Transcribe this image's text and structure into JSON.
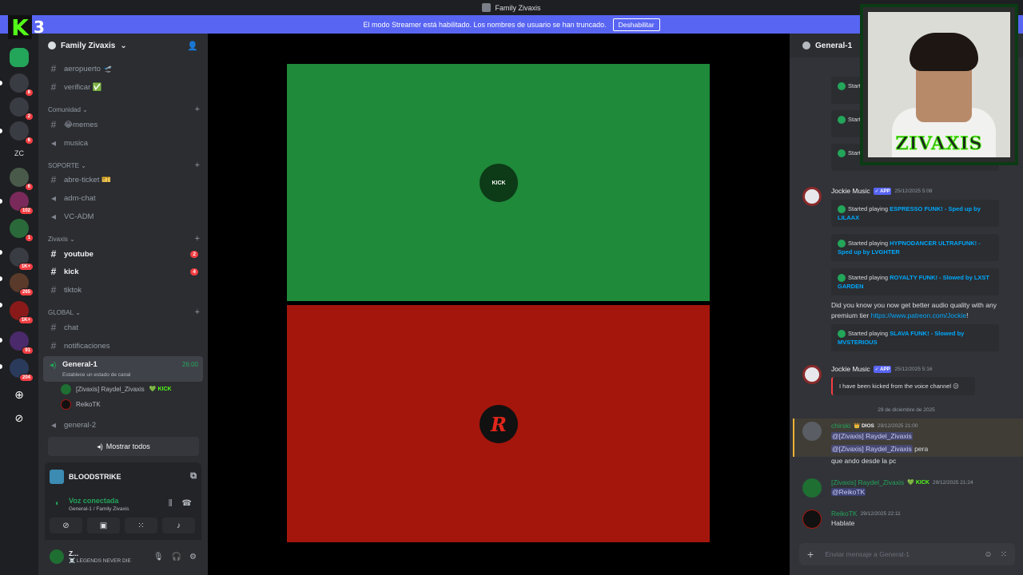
{
  "window": {
    "title": "Family Zivaxis"
  },
  "banner": {
    "text": "El modo Streamer está habilitado. Los nombres de usuario se han truncado.",
    "button": "Deshabilitar"
  },
  "overlay": {
    "kick_number": "3",
    "cam_brand": "ZIVAXIS"
  },
  "rail": {
    "servers": [
      {
        "label": "",
        "badge": ""
      },
      {
        "label": "",
        "badge": "8"
      },
      {
        "label": "",
        "badge": "2"
      },
      {
        "label": "",
        "badge": "6"
      },
      {
        "label": "ZC",
        "badge": ""
      },
      {
        "label": "",
        "badge": "6"
      },
      {
        "label": "",
        "badge": "102"
      },
      {
        "label": "",
        "badge": "1"
      },
      {
        "label": "",
        "badge": "1K+"
      },
      {
        "label": "",
        "badge": "265"
      },
      {
        "label": "",
        "badge": "1K+"
      },
      {
        "label": "",
        "badge": "91"
      },
      {
        "label": "",
        "badge": "204"
      }
    ]
  },
  "sidebar": {
    "guild_name": "Family Zivaxis",
    "channels_top": [
      {
        "name": "aeropuerto 🛫"
      },
      {
        "name": "verificar ✅"
      }
    ],
    "categories": {
      "comunidad": "Comunidad",
      "soporte": "SOPORTE",
      "zivaxis": "Zivaxis",
      "global": "GLOBAL"
    },
    "comunidad_channels": [
      "😂memes",
      "musica"
    ],
    "soporte_channels": [
      "abre-ticket 🎫",
      "adm-chat",
      "VC-ADM"
    ],
    "zivaxis_channels": [
      {
        "name": "youtube",
        "count": "2"
      },
      {
        "name": "kick",
        "count": "4"
      },
      {
        "name": "tiktok",
        "count": ""
      }
    ],
    "global_channels": [
      "chat",
      "notificaciones"
    ],
    "voice_channel": {
      "name": "General-1",
      "status": "Establece un estado de canal",
      "time": "26:00"
    },
    "voice_users": [
      {
        "name": "[Zivaxis] Raydel_Zivaxis",
        "tag": "💚 KICK"
      },
      {
        "name": "ReikoTK",
        "tag": ""
      }
    ],
    "general2": "general-2",
    "show_all": "Mostrar todos"
  },
  "activity": {
    "game": "BLOODSTRIKE"
  },
  "voice_panel": {
    "status": "Voz conectada",
    "sub": "General-1 / Family Zivaxis"
  },
  "user_panel": {
    "name": "Z...",
    "status": "☠️ LEGENDS NEVER DIE"
  },
  "chat": {
    "channel": "General-1",
    "messages": {
      "embed_top_partial": [
        "Started playing ... by A...",
        "Started playing ... sk8ta...",
        "Started playing ... Sped u..."
      ],
      "jockie1": {
        "author": "Jockie Music",
        "app": "✓ APP",
        "time": "25/12/2025 5:08",
        "embeds": [
          {
            "prefix": "Started playing ",
            "link": "ESPRESSO FUNK! - Sped up by LILAAX"
          },
          {
            "prefix": "Started playing ",
            "link": "HYPNODANCER ULTRAFUNK! - Sped up by LVGHTER"
          },
          {
            "prefix": "Started playing ",
            "link": "ROYALTY FUNK! - Slowed by LXST GARDEN"
          }
        ],
        "text": "Did you know you now get better audio quality with any premium tier ",
        "url": "https://www.patreon.com/Jockie",
        "embed4": {
          "prefix": "Started playing ",
          "link": "SLAVA FUNK! - Slowed by MVSTERIOUS"
        }
      },
      "jockie2": {
        "author": "Jockie Music",
        "app": "✓ APP",
        "time": "25/12/2025 5:16",
        "text": "I have been kicked from the voice channel 😕"
      },
      "date_divider": "29 de diciembre de 2025",
      "chirski": {
        "author": "chirski",
        "role": "👑 DIOS",
        "time": "29/12/2025 21:00",
        "mention1": "@[Zivaxis] Raydel_Zivaxis",
        "mention2": "@[Zivaxis] Raydel_Zivaxis",
        "text2": " pera",
        "text3": "que ando desde la pc"
      },
      "raydel": {
        "author": "[Zivaxis] Raydel_Zivaxis",
        "tag": "💚 KICK",
        "time": "29/12/2025 21:24",
        "mention": "@ReikoTK"
      },
      "reiko": {
        "author": "ReikoTK",
        "time": "29/12/2025 22:11",
        "text": "Hablate"
      }
    },
    "input_placeholder": "Enviar mensaje a General-1"
  },
  "colors": {
    "accent": "#5865f2",
    "online": "#23a55a",
    "kick_green": "#53fc18",
    "tile_green": "#1f8a3a",
    "tile_red": "#a4160c"
  }
}
